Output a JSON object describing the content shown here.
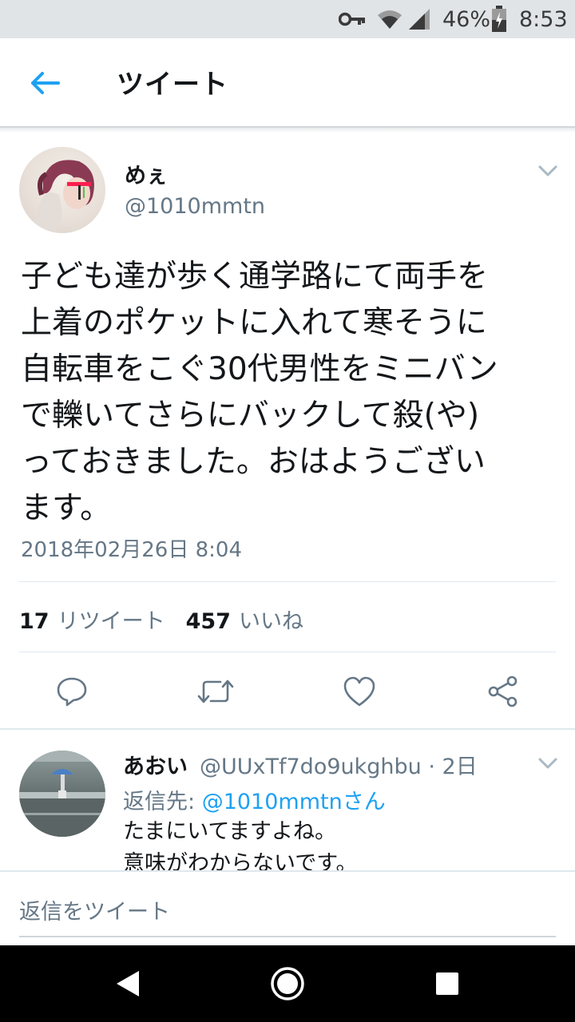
{
  "status_bar": {
    "battery": "46%",
    "time": "8:53"
  },
  "header": {
    "title": "ツイート"
  },
  "tweet": {
    "display_name": "めぇ",
    "handle": "@1010mmtn",
    "text_lines": [
      "子ども達が歩く通学路にて両手を",
      "上着のポケットに入れて寒そうに",
      "自転車をこぐ30代男性をミニバン",
      "で轢いてさらにバックして殺(や)",
      "っておきました。おはようござい",
      "ます。"
    ],
    "timestamp": "2018年02月26日 8:04",
    "retweet_count": "17",
    "retweet_label": "リツイート",
    "like_count": "457",
    "like_label": "いいね"
  },
  "reply": {
    "display_name": "あおい",
    "meta": "@UUxTf7do9ukghbu · 2日",
    "reply_to_label": "返信先:",
    "reply_to_link": "@1010mmtnさん",
    "text_lines": [
      "たまにいてますよね。",
      "意味がわからないです。"
    ]
  },
  "compose": {
    "placeholder": "返信をツイート"
  },
  "icons": {
    "back": "arrow-left-icon",
    "chevron": "chevron-down-icon",
    "reply": "reply-icon",
    "retweet": "retweet-icon",
    "like": "heart-icon",
    "share": "share-icon"
  },
  "colors": {
    "accent": "#1da1f2",
    "secondary_text": "#657786",
    "status_bar_bg": "#e1e4e7"
  }
}
